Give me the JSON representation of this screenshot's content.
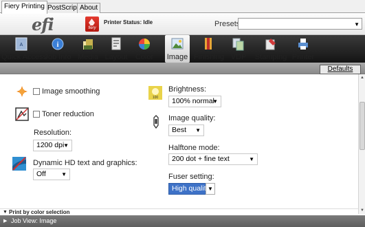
{
  "tabs": [
    {
      "label": "Fiery Printing"
    },
    {
      "label": "PostScript"
    },
    {
      "label": "About"
    }
  ],
  "header": {
    "logo_text": "efi",
    "fiery_badge": "fiery",
    "status": "Printer Status: Idle",
    "presets_label": "Presets:",
    "presets_value": ""
  },
  "toolbar": [
    {
      "label": "Quick Access",
      "icon": "quick-access-icon"
    },
    {
      "label": "Job Info",
      "icon": "info-icon"
    },
    {
      "label": "Media",
      "icon": "media-icon"
    },
    {
      "label": "Layout",
      "icon": "layout-icon"
    },
    {
      "label": "Color",
      "icon": "color-icon"
    },
    {
      "label": "Image",
      "icon": "image-icon"
    },
    {
      "label": "Finishing",
      "icon": "finishing-icon"
    },
    {
      "label": "VDP",
      "icon": "vdp-icon"
    },
    {
      "label": "Stamping",
      "icon": "stamping-icon"
    },
    {
      "label": "Printer",
      "icon": "printer-icon"
    }
  ],
  "active_tool": "Image",
  "defaults_label": "Defaults",
  "left": {
    "image_smoothing": {
      "label": "Image smoothing",
      "checked": false
    },
    "toner_reduction": {
      "label": "Toner reduction",
      "checked": false
    },
    "resolution_label": "Resolution:",
    "resolution_value": "1200 dpi",
    "dynamic_hd_label": "Dynamic HD text and graphics:",
    "dynamic_hd_value": "Off"
  },
  "right": {
    "brightness_label": "Brightness:",
    "brightness_value": "100% normal",
    "brightness_icon_text": "100",
    "image_quality_label": "Image quality:",
    "image_quality_value": "Best",
    "halftone_label": "Halftone mode:",
    "halftone_value": "200 dot + fine text",
    "fuser_label": "Fuser setting:",
    "fuser_value": "High quality"
  },
  "sections": {
    "print_by_color": "Print by color selection",
    "job_view": "Job View: Image"
  },
  "colors": {
    "toolbar_bg": "#1f1f1f",
    "selected_dropdown": "#3e72c7",
    "subbar_bg": "#999999"
  }
}
